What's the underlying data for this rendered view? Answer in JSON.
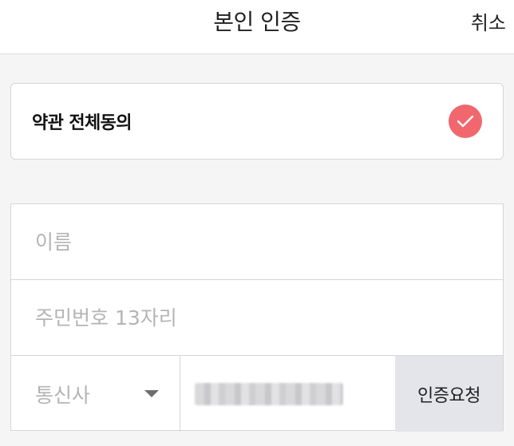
{
  "header": {
    "title": "본인 인증",
    "cancel_label": "취소"
  },
  "agreement": {
    "label": "약관 전체동의",
    "checked": true,
    "check_color": "#f0676e",
    "icon": "check-icon"
  },
  "form": {
    "name_placeholder": "이름",
    "name_value": "",
    "rrn_placeholder": "주민번호 13자리",
    "rrn_value": "",
    "carrier_label": "통신사",
    "carrier_icon": "chevron-down-icon",
    "request_label": "인증요청"
  },
  "colors": {
    "background": "#f5f5f6",
    "request_button_bg": "#e3e5ea",
    "placeholder": "#b4b4b4"
  }
}
